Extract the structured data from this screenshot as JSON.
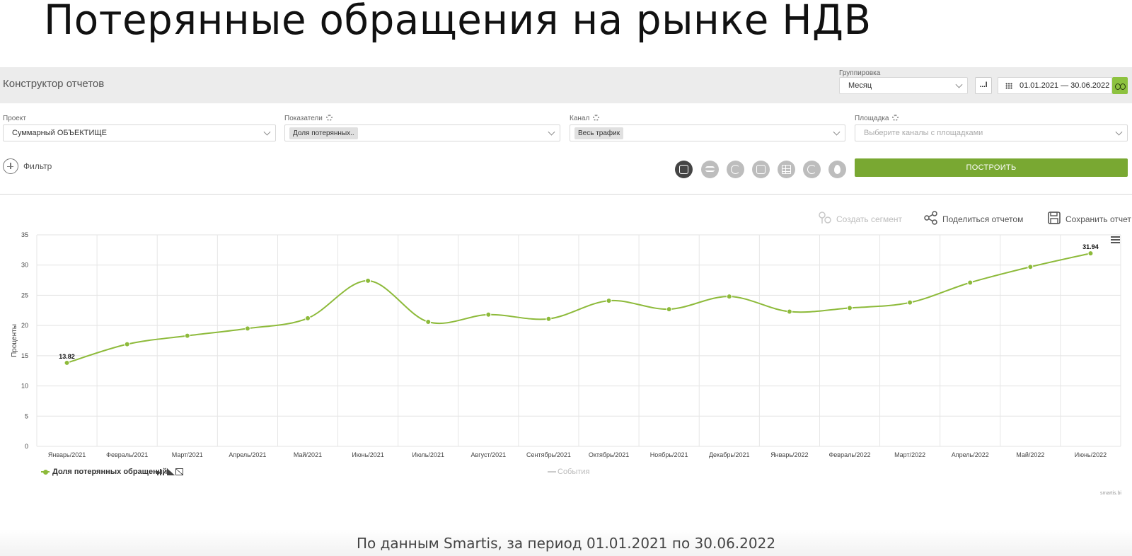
{
  "slide": {
    "title": "Потерянные обращения на рынке НДВ",
    "footer": "По данным Smartis, за период 01.01.2021 по 30.06.2022"
  },
  "header": {
    "app_title": "Конструктор отчетов",
    "grouping_label": "Группировка",
    "grouping_value": "Месяц",
    "more_button": "...l",
    "date_range": "01.01.2021 — 30.06.2022"
  },
  "filters": {
    "project": {
      "label": "Проект",
      "value": "Суммарный ОБЪЕКТИЩЕ"
    },
    "metrics": {
      "label": "Показатели",
      "chip": "Доля потерянных.."
    },
    "channel": {
      "label": "Канал",
      "chip": "Весь трафик"
    },
    "platform": {
      "label": "Площадка",
      "placeholder": "Выберите каналы с площадками"
    }
  },
  "toolbar": {
    "filter_label": "Фильтр",
    "build_button": "ПОСТРОИТЬ",
    "chart_types": [
      "combo-chart-icon",
      "waves-icon",
      "pie-icon",
      "map-icon",
      "table-icon",
      "gauge-icon",
      "drop-icon"
    ]
  },
  "actions": {
    "create_segment": "Создать сегмент",
    "share_report": "Поделиться отчетом",
    "save_report": "Сохранить отчет"
  },
  "legend": {
    "series_label": "Доля потерянных обращений",
    "events_label": "События"
  },
  "credit": "smartis.bi",
  "colors": {
    "accent": "#79a832",
    "line": "#8dba3a",
    "header_bg": "#ececec"
  },
  "chart_data": {
    "type": "line",
    "ylabel": "Проценты",
    "ylim": [
      0,
      35
    ],
    "yticks": [
      0,
      5,
      10,
      15,
      20,
      25,
      30,
      35
    ],
    "grid": true,
    "categories": [
      "Январь/2021",
      "Февраль/2021",
      "Март/2021",
      "Апрель/2021",
      "Май/2021",
      "Июнь/2021",
      "Июль/2021",
      "Август/2021",
      "Сентябрь/2021",
      "Октябрь/2021",
      "Ноябрь/2021",
      "Декабрь/2021",
      "Январь/2022",
      "Февраль/2022",
      "Март/2022",
      "Апрель/2022",
      "Май/2022",
      "Июнь/2022"
    ],
    "series": [
      {
        "name": "Доля потерянных обращений",
        "values": [
          13.82,
          16.9,
          18.3,
          19.5,
          21.2,
          27.4,
          20.6,
          21.8,
          21.1,
          24.1,
          22.7,
          24.8,
          22.3,
          22.9,
          23.8,
          27.1,
          29.7,
          31.94
        ]
      }
    ],
    "data_labels": [
      {
        "index": 0,
        "text": "13.82"
      },
      {
        "index": 17,
        "text": "31.94"
      }
    ]
  }
}
